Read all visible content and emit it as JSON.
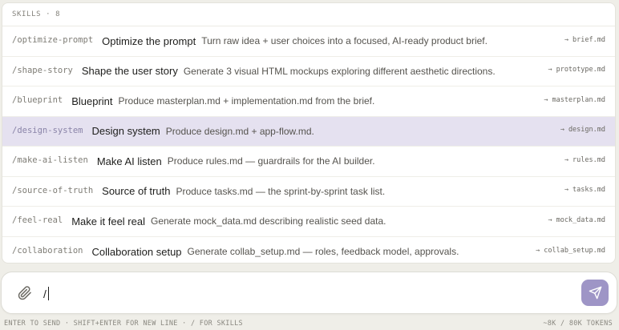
{
  "skills_panel": {
    "header": "SKILLS · 8",
    "items": [
      {
        "command": "/optimize-prompt",
        "name": "Optimize the prompt",
        "description": "Turn raw idea + user choices into a focused, AI-ready product brief.",
        "output": "→ brief.md",
        "selected": false
      },
      {
        "command": "/shape-story",
        "name": "Shape the user story",
        "description": "Generate 3 visual HTML mockups exploring different aesthetic directions.",
        "output": "→ prototype.md",
        "selected": false
      },
      {
        "command": "/blueprint",
        "name": "Blueprint",
        "description": "Produce masterplan.md + implementation.md from the brief.",
        "output": "→ masterplan.md",
        "selected": false
      },
      {
        "command": "/design-system",
        "name": "Design system",
        "description": "Produce design.md + app-flow.md.",
        "output": "→ design.md",
        "selected": true
      },
      {
        "command": "/make-ai-listen",
        "name": "Make AI listen",
        "description": "Produce rules.md — guardrails for the AI builder.",
        "output": "→ rules.md",
        "selected": false
      },
      {
        "command": "/source-of-truth",
        "name": "Source of truth",
        "description": "Produce tasks.md — the sprint-by-sprint task list.",
        "output": "→ tasks.md",
        "selected": false
      },
      {
        "command": "/feel-real",
        "name": "Make it feel real",
        "description": "Generate mock_data.md describing realistic seed data.",
        "output": "→ mock_data.md",
        "selected": false
      },
      {
        "command": "/collaboration",
        "name": "Collaboration setup",
        "description": "Generate collab_setup.md — roles, feedback model, approvals.",
        "output": "→ collab_setup.md",
        "selected": false
      }
    ]
  },
  "composer": {
    "value": "/",
    "attach_icon": "paperclip-icon",
    "send_icon": "send-icon"
  },
  "footer": {
    "hint": "ENTER TO SEND · SHIFT+ENTER FOR NEW LINE · / FOR SKILLS",
    "tokens": "~8K / 80K TOKENS"
  },
  "colors": {
    "background": "#efeee8",
    "selected_row": "#e5e1f0",
    "send_button": "#9e95c6"
  }
}
